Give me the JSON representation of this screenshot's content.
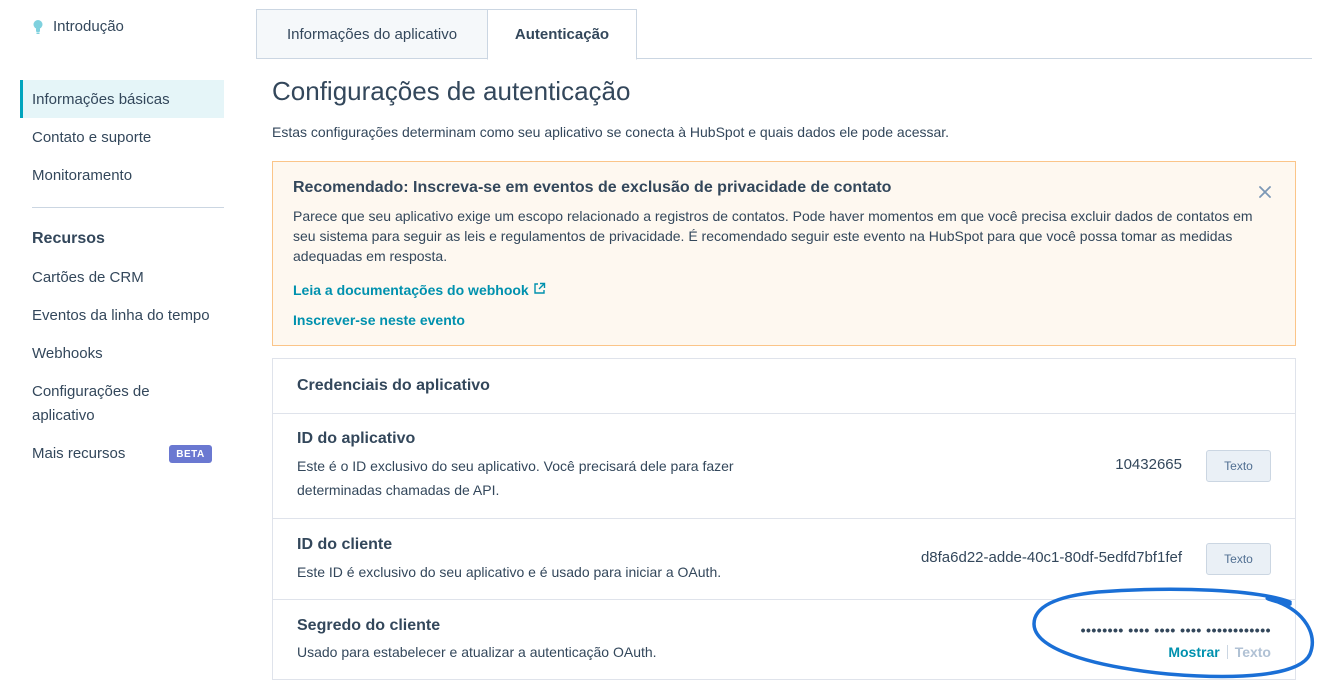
{
  "sidebar": {
    "intro": "Introdução",
    "items": [
      {
        "label": "Informações básicas"
      },
      {
        "label": "Contato e suporte"
      },
      {
        "label": "Monitoramento"
      }
    ],
    "resources_heading": "Recursos",
    "resources": [
      {
        "label": "Cartões de CRM"
      },
      {
        "label": "Eventos da linha do tempo"
      },
      {
        "label": "Webhooks"
      },
      {
        "label": "Configurações de aplicativo"
      },
      {
        "label": "Mais recursos",
        "badge": "BETA"
      }
    ]
  },
  "tabs": [
    {
      "label": "Informações do aplicativo"
    },
    {
      "label": "Autenticação"
    }
  ],
  "page": {
    "title": "Configurações de autenticação",
    "subtitle": "Estas configurações determinam como seu aplicativo se conecta à HubSpot e quais dados ele pode acessar."
  },
  "alert": {
    "title": "Recomendado: Inscreva-se em eventos de exclusão de privacidade de contato",
    "body": "Parece que seu aplicativo exige um escopo relacionado a registros de contatos. Pode haver momentos em que você precisa excluir dados de contatos em seu sistema para seguir as leis e regulamentos de privacidade. É recomendado seguir este evento na HubSpot para que você possa tomar as medidas adequadas em resposta.",
    "link_docs": "Leia a documentações do webhook",
    "link_subscribe": "Inscrever-se neste evento"
  },
  "credentials": {
    "heading": "Credenciais do aplicativo",
    "app_id": {
      "title": "ID do aplicativo",
      "desc": "Este é o ID exclusivo do seu aplicativo. Você precisará dele para fazer determinadas chamadas de API.",
      "value": "10432665",
      "copy": "Texto"
    },
    "client_id": {
      "title": "ID do cliente",
      "desc": "Este ID é exclusivo do seu aplicativo e é usado para iniciar a OAuth.",
      "value": "d8fa6d22-adde-40c1-80df-5edfd7bf1fef",
      "copy": "Texto"
    },
    "client_secret": {
      "title": "Segredo do cliente",
      "desc": "Usado para estabelecer e atualizar a autenticação OAuth.",
      "masked": "•••••••• •••• •••• •••• ••••••••••••",
      "show": "Mostrar",
      "copy": "Texto"
    }
  },
  "colors": {
    "accent": "#00a4bd",
    "link": "#0091ae",
    "alert_bg": "#fef8f0",
    "alert_border": "#fbc589",
    "annotation": "#1a6fd6"
  }
}
